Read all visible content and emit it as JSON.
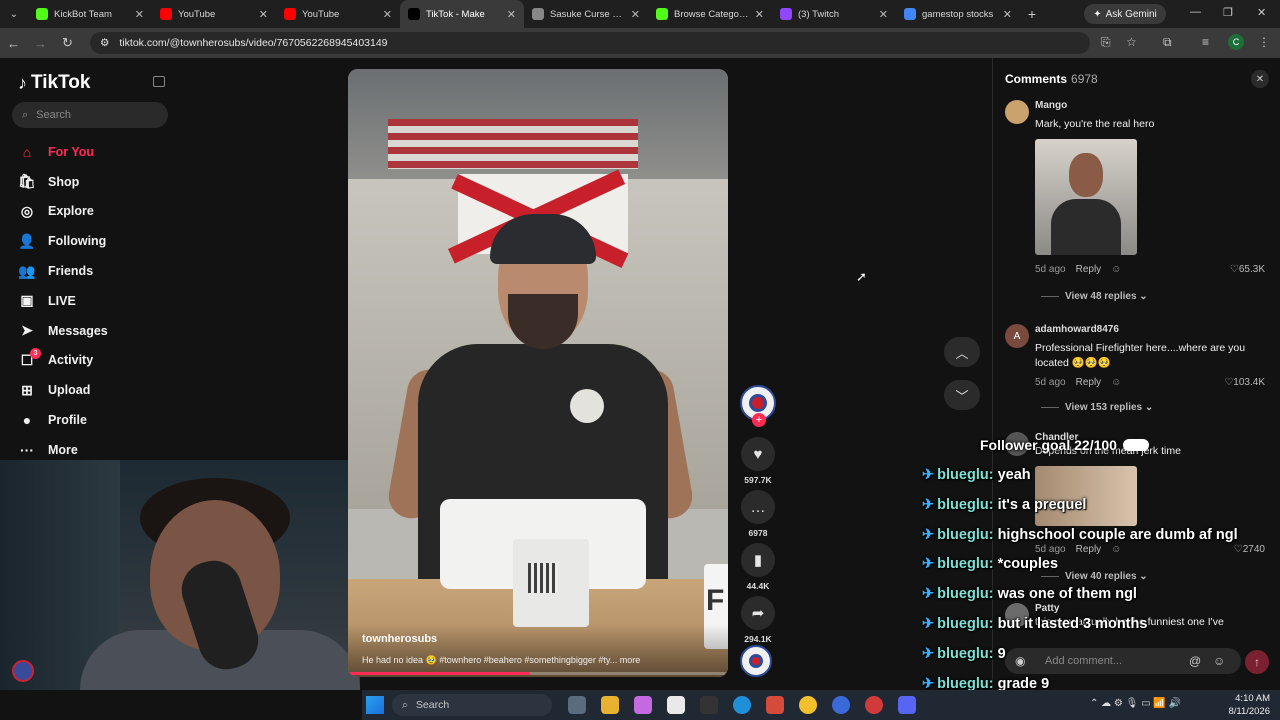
{
  "browser": {
    "tabs": [
      {
        "label": "KickBot Team",
        "color": "#53fc18",
        "active": false
      },
      {
        "label": "YouTube",
        "color": "#ff0000",
        "active": false
      },
      {
        "label": "YouTube",
        "color": "#ff0000",
        "active": false
      },
      {
        "label": "TikTok - Make",
        "color": "#000000",
        "active": true
      },
      {
        "label": "Sasuke Curse Ma",
        "color": "#888888",
        "active": false
      },
      {
        "label": "Browse Categorie",
        "color": "#53fc18",
        "active": false
      },
      {
        "label": "(3) Twitch",
        "color": "#9146ff",
        "active": false
      },
      {
        "label": "gamestop stocks",
        "color": "#4285f4",
        "active": false
      }
    ],
    "gemini_label": "Ask Gemini",
    "url": "tiktok.com/@townherosubs/video/7670562268945403149",
    "profile_initial": "C"
  },
  "sidebar": {
    "logo_text": "TikTok",
    "search_placeholder": "Search",
    "items": [
      {
        "label": "For You",
        "icon": "home-icon",
        "glyph": "⌂"
      },
      {
        "label": "Shop",
        "icon": "shop-icon",
        "glyph": "🛍"
      },
      {
        "label": "Explore",
        "icon": "compass-icon",
        "glyph": "◎"
      },
      {
        "label": "Following",
        "icon": "following-icon",
        "glyph": "👤"
      },
      {
        "label": "Friends",
        "icon": "friends-icon",
        "glyph": "👥"
      },
      {
        "label": "LIVE",
        "icon": "live-icon",
        "glyph": "▣"
      },
      {
        "label": "Messages",
        "icon": "messages-icon",
        "glyph": "➤"
      },
      {
        "label": "Activity",
        "icon": "activity-icon",
        "glyph": "☐",
        "badge": "3"
      },
      {
        "label": "Upload",
        "icon": "upload-icon",
        "glyph": "⊞"
      },
      {
        "label": "Profile",
        "icon": "profile-icon",
        "glyph": "●"
      },
      {
        "label": "More",
        "icon": "more-icon",
        "glyph": "···"
      }
    ]
  },
  "video": {
    "username": "townherosubs",
    "caption": "He had no idea 🥹 #townhero #beahero #somethingbigger #ty...  more",
    "progress": 0.48
  },
  "actions": {
    "likes": "597.7K",
    "comments": "6978",
    "saves": "44.4K",
    "shares": "294.1K"
  },
  "comments_panel": {
    "title": "Comments",
    "count": "6978",
    "input_placeholder": "Add comment...",
    "items": [
      {
        "user": "Mango",
        "text": "Mark, you're the real hero",
        "time": "5d ago",
        "reply": "Reply",
        "likes": "65.3K",
        "view_replies": "View 48 replies"
      },
      {
        "user": "adamhoward8476",
        "avatar_letter": "A",
        "text": "Professional Firefighter here....where are you located 🥺🥺🥺",
        "time": "5d ago",
        "reply": "Reply",
        "likes": "103.4K",
        "view_replies": "View 153 replies"
      },
      {
        "user": "Chandler",
        "text": "Depends on the mean jerk time",
        "time": "5d ago",
        "reply": "Reply",
        "likes": "2740",
        "view_replies": "View 40 replies"
      },
      {
        "user": "Patty",
        "text": "this may actually be the funniest one I've"
      }
    ]
  },
  "overlay": {
    "goal": "Follower goal 22/100",
    "chat": [
      {
        "user": "blueglu:",
        "msg": "yeah"
      },
      {
        "user": "blueglu:",
        "msg": "it's a prequel"
      },
      {
        "user": "blueglu:",
        "msg": "highschool couple are dumb af ngl"
      },
      {
        "user": "blueglu:",
        "msg": "*couples"
      },
      {
        "user": "blueglu:",
        "msg": "was one of them ngl"
      },
      {
        "user": "blueglu:",
        "msg": "but it lasted 3 months"
      },
      {
        "user": "blueglu:",
        "msg": "9"
      },
      {
        "user": "blueglu:",
        "msg": "grade 9"
      }
    ]
  },
  "taskbar": {
    "search_placeholder": "Search",
    "time": "4:10 AM",
    "date": "8/11/2026"
  }
}
